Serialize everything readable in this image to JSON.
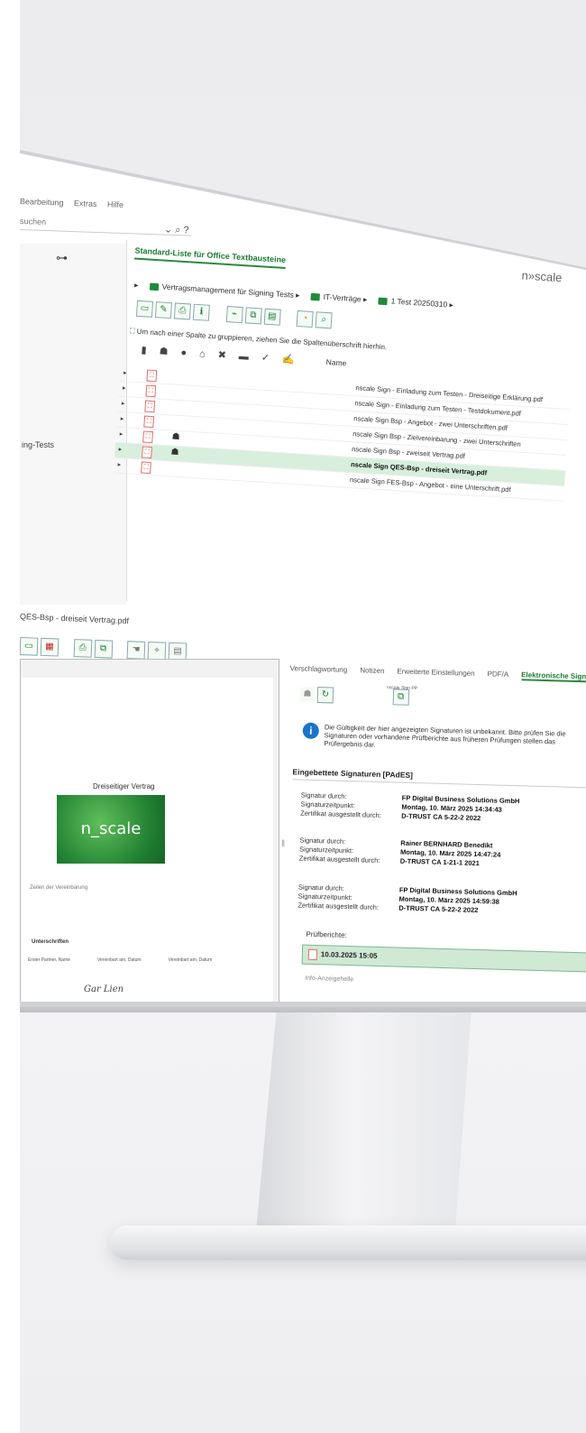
{
  "menubar": [
    "Bearbeitung",
    "Extras",
    "Hilfe"
  ],
  "search": {
    "value": "suchen",
    "icons": "⌄ ⌕ ?"
  },
  "left_pane": {
    "item_partial": "ing-Tests"
  },
  "upper": {
    "title": "Standard-Liste für Office Textbausteine",
    "logo": "n»scale",
    "breadcrumb": [
      "Vertragsmanagement für Signing Tests",
      "IT-Verträge",
      "1 Test 20250310"
    ],
    "group_hint": "Um nach einer Spalte zu gruppieren, ziehen Sie die Spaltenüberschrift hierhin.",
    "name_header": "Name",
    "rows": [
      {
        "name": "nscale Sign - Einladung zum Testen - Dreiseitige Erklärung.pdf",
        "selected": false,
        "user": false
      },
      {
        "name": "nscale Sign - Einladung zum Testen - Testdokument.pdf",
        "selected": false,
        "user": false
      },
      {
        "name": "nscale Sign Bsp - Angebot - zwei Unterschriften.pdf",
        "selected": false,
        "user": false
      },
      {
        "name": "nscale Sign Bsp - Zielvereinbarung - zwei Unterschriften",
        "selected": false,
        "user": false
      },
      {
        "name": "nscale Sign Bsp - zweiseit Vertrag.pdf",
        "selected": false,
        "user": true
      },
      {
        "name": "nscale Sign QES-Bsp - dreiseit Vertrag.pdf",
        "selected": true,
        "user": true
      },
      {
        "name": "nscale Sign FES-Bsp - Angebot - eine Unterschrift.pdf",
        "selected": false,
        "user": false
      }
    ]
  },
  "lower": {
    "window_title": "QES-Bsp - dreiseit Vertrag.pdf",
    "doc": {
      "title": "Dreiseitiger Vertrag",
      "logo": "n_scale",
      "line": "Zeilen der Vereinbarung",
      "sig_label": "Unterschriften",
      "cols": [
        "Erster Partner, Name",
        "Vereinbart am, Datum",
        "Vereinbart am, Datum"
      ],
      "sign": "Gar Lien"
    },
    "tabs": [
      "Verschlagwortung",
      "Notizen",
      "Erweiterte Einstellungen",
      "PDF/A",
      "Elektronische Signaturen"
    ],
    "tool_small_label": "nscale Sign PP",
    "info_text": "Die Gültigkeit der hier angezeigten Signaturen ist unbekannt. Bitte prüfen Sie die Signaturen oder vorhandene Prüfberichte aus früheren Prüfungen stellen das Prüfergebnis dar.",
    "section_title": "Eingebettete Signaturen [PAdES]",
    "signatures": [
      {
        "signer": "FP Digital Business Solutions GmbH",
        "time": "Montag, 10. März 2025 14:34:43",
        "issuer": "D-TRUST CA 5-22-2 2022"
      },
      {
        "signer": "Rainer BERNHARD Benedikt",
        "time": "Montag, 10. März 2025 14:47:24",
        "issuer": "D-TRUST CA 1-21-1 2021"
      },
      {
        "signer": "FP Digital Business Solutions GmbH",
        "time": "Montag, 10. März 2025 14:59:38",
        "issuer": "D-TRUST CA 5-22-2 2022"
      }
    ],
    "labels": {
      "signer": "Signatur durch:",
      "time": "Signaturzeitpunkt:",
      "issuer": "Zertifikat ausgestellt durch:"
    },
    "pb_label": "Prüfberichte:",
    "pb_row": "10.03.2025 15:05",
    "bottom_partial": "Info-Anzeigehelle"
  }
}
